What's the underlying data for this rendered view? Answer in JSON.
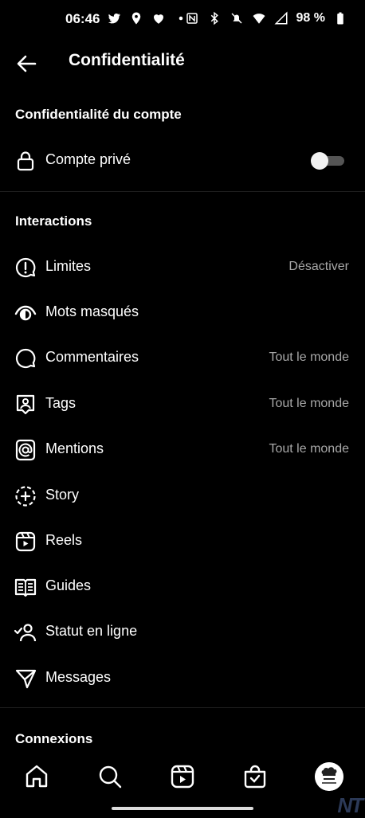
{
  "status_bar": {
    "time": "06:46",
    "battery": "98 %",
    "left_icons": [
      "twitter-icon",
      "location-icon",
      "heart-icon",
      "dot-icon"
    ],
    "right_icons": [
      "nfc-icon",
      "bluetooth-icon",
      "mute-icon",
      "wifi-icon",
      "signal-icon",
      "battery-icon"
    ]
  },
  "header": {
    "title": "Confidentialité"
  },
  "account_section": {
    "title": "Confidentialité du compte",
    "private_account": {
      "label": "Compte privé",
      "enabled": false
    }
  },
  "interactions": {
    "title": "Interactions",
    "items": [
      {
        "label": "Limites",
        "value": "Désactiver",
        "icon": "limits-icon"
      },
      {
        "label": "Mots masqués",
        "value": "",
        "icon": "hidden-words-icon"
      },
      {
        "label": "Commentaires",
        "value": "Tout le monde",
        "icon": "comment-icon"
      },
      {
        "label": "Tags",
        "value": "Tout le monde",
        "icon": "tag-person-icon"
      },
      {
        "label": "Mentions",
        "value": "Tout le monde",
        "icon": "at-icon"
      },
      {
        "label": "Story",
        "value": "",
        "icon": "story-add-icon"
      },
      {
        "label": "Reels",
        "value": "",
        "icon": "reels-icon"
      },
      {
        "label": "Guides",
        "value": "",
        "icon": "guides-icon"
      },
      {
        "label": "Statut en ligne",
        "value": "",
        "icon": "online-status-icon"
      },
      {
        "label": "Messages",
        "value": "",
        "icon": "send-icon"
      }
    ]
  },
  "connections": {
    "title": "Connexions"
  },
  "bottom_nav": [
    "home-icon",
    "search-icon",
    "reels-icon",
    "shop-icon",
    "profile-avatar"
  ],
  "watermark": "NT"
}
